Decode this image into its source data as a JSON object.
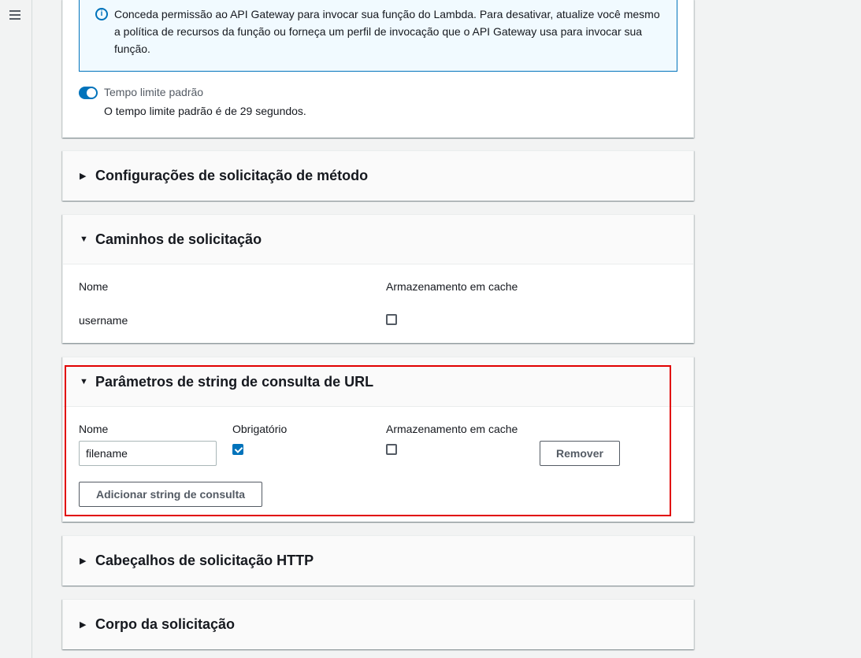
{
  "info_box": {
    "text": "Conceda permissão ao API Gateway para invocar sua função do Lambda. Para desativar, atualize você mesmo a política de recursos da função ou forneça um perfil de invocação que o API Gateway usa para invocar sua função."
  },
  "timeout": {
    "label": "Tempo limite padrão",
    "description": "O tempo limite padrão é de 29 segundos.",
    "enabled": true
  },
  "sections": {
    "method_request_settings": {
      "title": "Configurações de solicitação de método",
      "expanded": false
    },
    "request_paths": {
      "title": "Caminhos de solicitação",
      "expanded": true,
      "col_name": "Nome",
      "col_cache": "Armazenamento em cache",
      "rows": [
        {
          "name": "username",
          "cache": false
        }
      ]
    },
    "query_strings": {
      "title": "Parâmetros de string de consulta de URL",
      "expanded": true,
      "col_name": "Nome",
      "col_required": "Obrigatório",
      "col_cache": "Armazenamento em cache",
      "rows": [
        {
          "name": "filename",
          "required": true,
          "cache": false
        }
      ],
      "remove_label": "Remover",
      "add_label": "Adicionar string de consulta"
    },
    "http_headers": {
      "title": "Cabeçalhos de solicitação HTTP",
      "expanded": false
    },
    "request_body": {
      "title": "Corpo da solicitação",
      "expanded": false
    }
  },
  "icons": {
    "menu": "hamburger-icon",
    "info": "info-icon",
    "expanded": "caret-down-icon",
    "collapsed": "caret-right-icon"
  },
  "colors": {
    "accent": "#0073bb",
    "highlight": "#e10000",
    "page_bg": "#f2f3f3"
  }
}
